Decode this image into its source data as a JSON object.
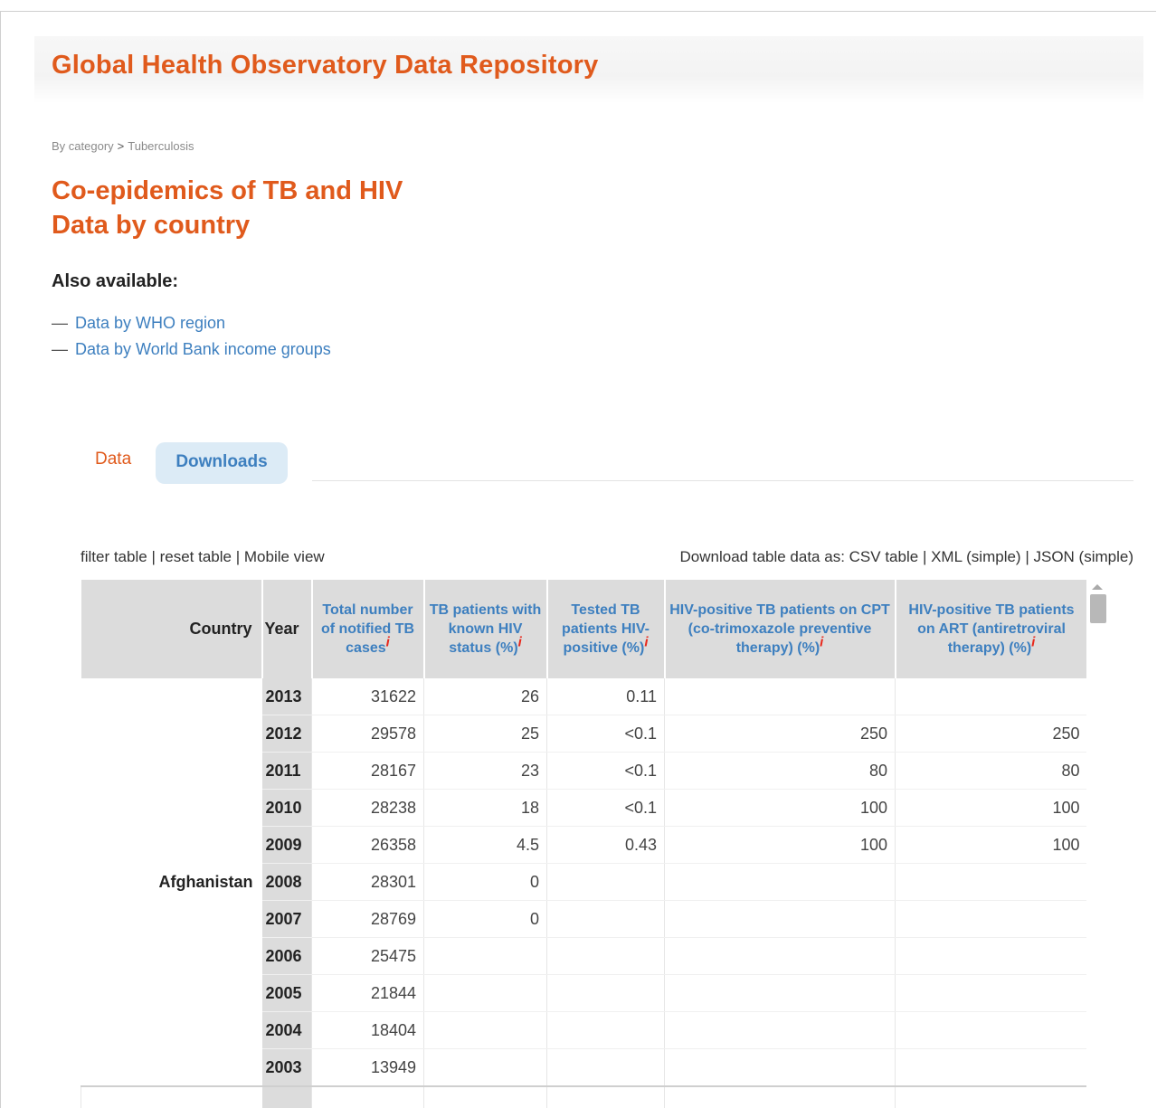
{
  "site": {
    "title": "Global Health Observatory Data Repository"
  },
  "breadcrumb": {
    "root": "By category",
    "separator": ">",
    "current": "Tuberculosis"
  },
  "page": {
    "title_line1": "Co-epidemics of TB and HIV",
    "title_line2": "Data by country"
  },
  "also_available": {
    "heading": "Also available:",
    "items": [
      {
        "label": "Data by WHO region"
      },
      {
        "label": "Data by World Bank income groups"
      }
    ]
  },
  "tabs": {
    "active": "Data",
    "other": "Downloads"
  },
  "table_tools": {
    "filter": "filter table",
    "reset": "reset table",
    "mobile": "Mobile view",
    "sep": "|"
  },
  "downloads": {
    "prefix": "Download table data as:",
    "csv": "CSV table",
    "xml": "XML (simple)",
    "json": "JSON (simple)"
  },
  "table": {
    "headers": {
      "country": "Country",
      "year": "Year",
      "total": "Total number of notified TB cases",
      "known": "TB patients with known HIV status (%)",
      "tested": "Tested TB patients HIV-positive (%)",
      "cpt": "HIV-positive TB patients on CPT (co-trimoxazole preventive therapy) (%)",
      "art": "HIV-positive TB patients on ART (antiretroviral therapy) (%)"
    },
    "info_mark": "i",
    "country": "Afghanistan",
    "rows": [
      {
        "year": "2013",
        "total": "31622",
        "known": "26",
        "tested": "0.11",
        "cpt": "",
        "art": ""
      },
      {
        "year": "2012",
        "total": "29578",
        "known": "25",
        "tested": "<0.1",
        "cpt": "250",
        "art": "250"
      },
      {
        "year": "2011",
        "total": "28167",
        "known": "23",
        "tested": "<0.1",
        "cpt": "80",
        "art": "80"
      },
      {
        "year": "2010",
        "total": "28238",
        "known": "18",
        "tested": "<0.1",
        "cpt": "100",
        "art": "100"
      },
      {
        "year": "2009",
        "total": "26358",
        "known": "4.5",
        "tested": "0.43",
        "cpt": "100",
        "art": "100"
      },
      {
        "year": "2008",
        "total": "28301",
        "known": "0",
        "tested": "",
        "cpt": "",
        "art": ""
      },
      {
        "year": "2007",
        "total": "28769",
        "known": "0",
        "tested": "",
        "cpt": "",
        "art": ""
      },
      {
        "year": "2006",
        "total": "25475",
        "known": "",
        "tested": "",
        "cpt": "",
        "art": ""
      },
      {
        "year": "2005",
        "total": "21844",
        "known": "",
        "tested": "",
        "cpt": "",
        "art": ""
      },
      {
        "year": "2004",
        "total": "18404",
        "known": "",
        "tested": "",
        "cpt": "",
        "art": ""
      },
      {
        "year": "2003",
        "total": "13949",
        "known": "",
        "tested": "",
        "cpt": "",
        "art": ""
      }
    ]
  },
  "colors": {
    "brand_orange": "#e05a1c",
    "link_blue": "#3d7fbf",
    "header_gray": "#dcdcdc",
    "info_red": "#e8281c"
  }
}
